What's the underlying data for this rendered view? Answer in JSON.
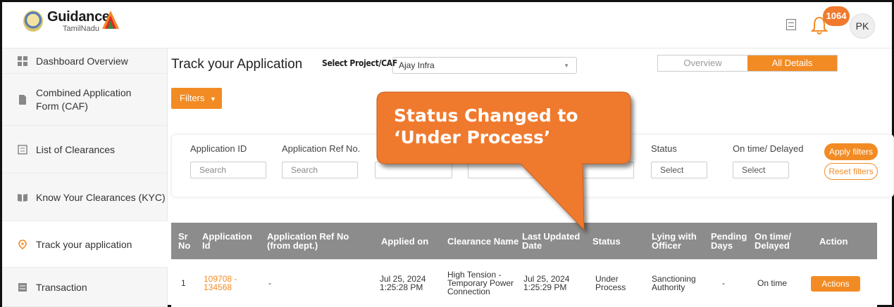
{
  "header": {
    "logo_title": "Guidance",
    "logo_sub": "TamilNadu",
    "notification_count": "1064",
    "avatar_initials": "PK"
  },
  "sidebar": {
    "items": [
      {
        "label": "Dashboard Overview",
        "icon": "dashboard-icon"
      },
      {
        "label": "Combined Application Form (CAF)",
        "icon": "document-icon"
      },
      {
        "label": "List of Clearances",
        "icon": "list-icon"
      },
      {
        "label": "Know Your Clearances (KYC)",
        "icon": "book-icon"
      },
      {
        "label": "Track your application",
        "icon": "location-pin-icon",
        "active": true
      },
      {
        "label": "Transaction",
        "icon": "transaction-icon"
      }
    ]
  },
  "main": {
    "title": "Track your Application",
    "select_label": "Select Project/CAF",
    "select_value": "Ajay Infra",
    "toggle": {
      "overview": "Overview",
      "all_details": "All Details"
    },
    "filters_button": "Filters",
    "filters": {
      "application_id_label": "Application ID",
      "application_id_placeholder": "Search",
      "application_ref_label": "Application Ref No.",
      "application_ref_placeholder": "Search",
      "status_label": "Status",
      "status_placeholder": "Select",
      "ontime_label": "On time/ Delayed",
      "ontime_placeholder": "Select",
      "apply": "Apply filters",
      "reset": "Reset filters"
    },
    "table": {
      "headers": [
        "Sr No",
        "Application Id",
        "Application Ref No (from dept.)",
        "Applied on",
        "Clearance Name",
        "Last Updated Date",
        "Status",
        "Lying with Officer",
        "Pending Days",
        "On time/ Delayed",
        "Action"
      ],
      "rows": [
        {
          "sr": "1",
          "app_id": "109708 - 134568",
          "ref_no": "-",
          "applied_on": "Jul 25, 2024 1:25:28 PM",
          "clearance": "High Tension - Temporary Power Connection",
          "last_updated": "Jul 25, 2024 1:25:29 PM",
          "status": "Under Process",
          "lying_with": "Sanctioning Authority",
          "pending_days": "-",
          "on_time": "On time",
          "action": "Actions"
        }
      ]
    }
  },
  "callout": {
    "text": "Status Changed to ‘Under Process’"
  },
  "colors": {
    "accent": "#f28b24",
    "callout": "#ef7a2e",
    "table_header": "#8c8c8c"
  }
}
